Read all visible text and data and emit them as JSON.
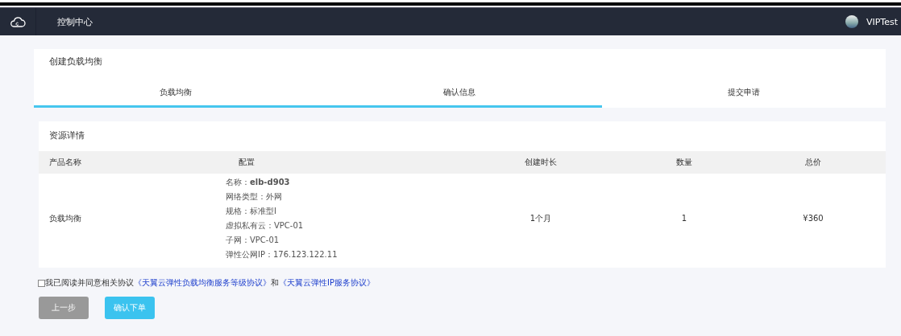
{
  "nav": {
    "title": "控制中心",
    "user": "VIPTest"
  },
  "wizard": {
    "title": "创建负载均衡",
    "steps": [
      {
        "label": "负载均衡",
        "active": true
      },
      {
        "label": "确认信息",
        "active": true
      },
      {
        "label": "提交申请",
        "active": false
      }
    ]
  },
  "details": {
    "title": "资源详情",
    "columns": [
      "产品名称",
      "配置",
      "创建时长",
      "数量",
      "总价"
    ],
    "rows": [
      {
        "product": "负载均衡",
        "config": [
          "名称：**elb-d903**",
          "网络类型：外网",
          "规格：标准型I",
          "虚拟私有云：VPC-01",
          "子网：VPC-01",
          "弹性公网IP：176.123.122.11"
        ],
        "duration": "1个月",
        "quantity": "1",
        "price": "¥360"
      }
    ]
  },
  "agreement": {
    "checked": false,
    "text": "我已阅读并同意相关协议",
    "links": [
      "《天翼云弹性负载均衡服务等级协议》",
      "《天翼云弹性IP服务协议》"
    ],
    "joiner": "和"
  },
  "buttons": [
    {
      "label": "上一步",
      "kind": "secondary"
    },
    {
      "label": "确认下单",
      "kind": "primary"
    }
  ]
}
